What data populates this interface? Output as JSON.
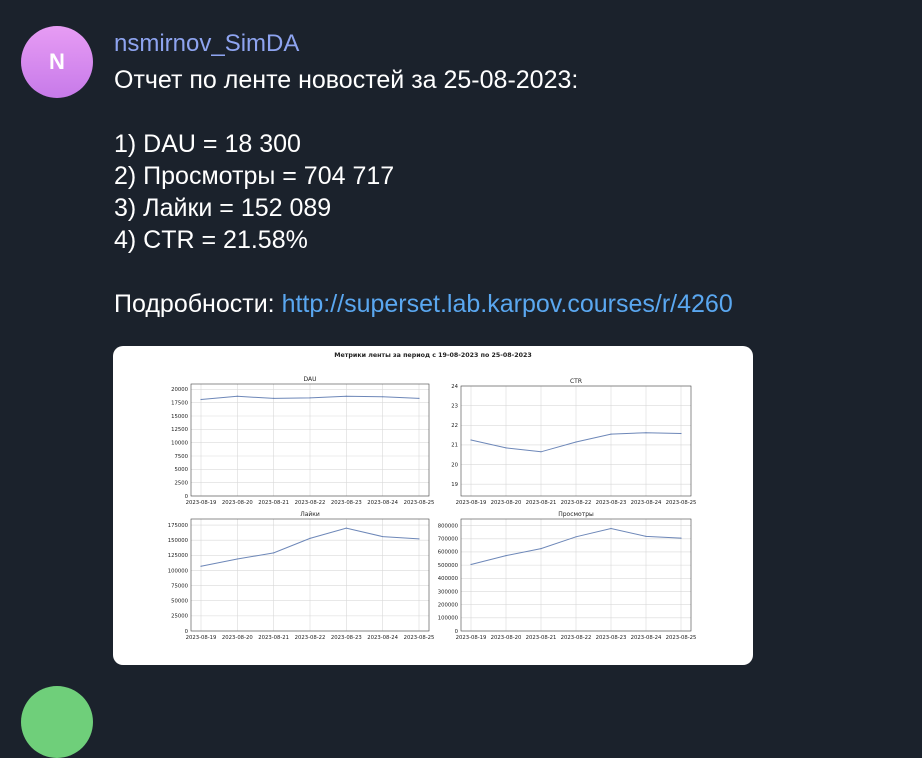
{
  "avatar": {
    "letter": "N"
  },
  "message": {
    "author": "nsmirnov_SimDA",
    "lines": [
      "Отчет по ленте новостей за 25-08-2023:",
      "",
      "1) DAU = 18 300",
      "2) Просмотры = 704 717",
      "3) Лайки = 152 089",
      "4) CTR = 21.58%",
      ""
    ],
    "details_label": "Подробности: ",
    "details_link": "http://superset.lab.karpov.courses/r/4260"
  },
  "chart_data": {
    "title": "Метрики ленты за период с 19-08-2023 по 25-08-2023",
    "x": [
      "2023-08-19",
      "2023-08-20",
      "2023-08-21",
      "2023-08-22",
      "2023-08-23",
      "2023-08-24",
      "2023-08-25"
    ],
    "charts": [
      {
        "title": "DAU",
        "type": "line",
        "ylim": [
          0,
          21000
        ],
        "yticks": [
          0,
          2500,
          5000,
          7500,
          10000,
          12500,
          15000,
          17500,
          20000
        ],
        "values": [
          18100,
          18700,
          18300,
          18400,
          18700,
          18600,
          18300
        ]
      },
      {
        "title": "CTR",
        "type": "line",
        "ylim": [
          18.4,
          24
        ],
        "yticks": [
          19,
          20,
          21,
          22,
          23,
          24
        ],
        "values": [
          21.25,
          20.85,
          20.65,
          21.15,
          21.55,
          21.62,
          21.58
        ]
      },
      {
        "title": "Лайки",
        "type": "line",
        "ylim": [
          0,
          185000
        ],
        "yticks": [
          0,
          25000,
          50000,
          75000,
          100000,
          125000,
          150000,
          175000
        ],
        "values": [
          107000,
          119000,
          129000,
          153000,
          170000,
          156000,
          152089
        ]
      },
      {
        "title": "Просмотры",
        "type": "line",
        "ylim": [
          0,
          850000
        ],
        "yticks": [
          0,
          100000,
          200000,
          300000,
          400000,
          500000,
          600000,
          700000,
          800000
        ],
        "values": [
          505000,
          572000,
          625000,
          715000,
          778000,
          718000,
          704717
        ]
      }
    ]
  }
}
